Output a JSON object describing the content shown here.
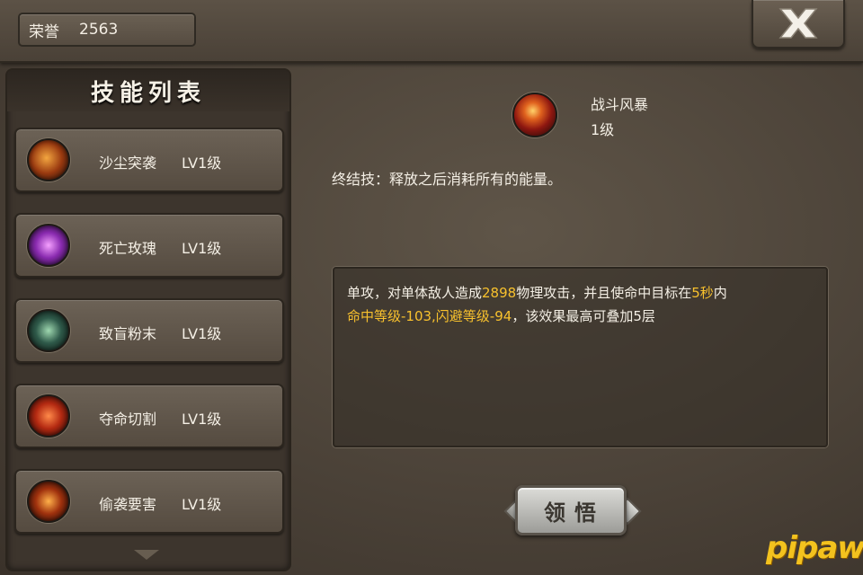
{
  "honor": {
    "label": "荣誉",
    "value": "2563"
  },
  "close_icon": "close-x-icon",
  "skill_list": {
    "title": "技能列表",
    "items": [
      {
        "name": "沙尘突袭",
        "level": "LV1级",
        "icon": "sand-strike-icon",
        "colors": [
          "#f3a640",
          "#9a3a10",
          "#2a120a"
        ]
      },
      {
        "name": "死亡玫瑰",
        "level": "LV1级",
        "icon": "death-rose-icon",
        "colors": [
          "#f5a0ff",
          "#8a2bb0",
          "#1e0a28"
        ]
      },
      {
        "name": "致盲粉末",
        "level": "LV1级",
        "icon": "blinding-powder-icon",
        "colors": [
          "#9fd8b0",
          "#2f5a4a",
          "#0d1814"
        ]
      },
      {
        "name": "夺命切割",
        "level": "LV1级",
        "icon": "deadly-cut-icon",
        "colors": [
          "#ff8a4a",
          "#b42a12",
          "#2a0806"
        ]
      },
      {
        "name": "偷袭要害",
        "level": "LV1级",
        "icon": "sneak-attack-icon",
        "colors": [
          "#ffb04a",
          "#a0320e",
          "#1c0806"
        ]
      }
    ]
  },
  "detail": {
    "icon": "battle-storm-icon",
    "name": "战斗风暴",
    "level": "1级",
    "type_text": "终结技：释放之后消耗所有的能量。",
    "desc": {
      "p1": "单攻，对单体敌人造成",
      "damage": "2898",
      "p2": "物理攻击，并且使命中目标在",
      "duration": "5秒",
      "p3": "内",
      "debuff": "命中等级-103,闪避等级-94",
      "p4": "，该效果最高可叠加5层"
    }
  },
  "learn_button": {
    "label": "领悟"
  },
  "watermark": "pipaw",
  "colors": {
    "highlight": "#f8c12d",
    "text": "#f4efe5"
  }
}
